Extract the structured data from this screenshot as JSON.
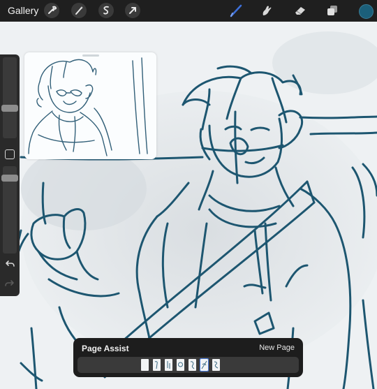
{
  "topbar": {
    "gallery_label": "Gallery",
    "tools_left": [
      {
        "icon": "wrench-icon",
        "name": "actions"
      },
      {
        "icon": "magic-wand-icon",
        "name": "adjustments"
      },
      {
        "icon": "selection-icon",
        "name": "selection"
      },
      {
        "icon": "arrow-cursor-icon",
        "name": "transform"
      }
    ],
    "tools_right": [
      {
        "icon": "brush-icon",
        "name": "brush",
        "active": true
      },
      {
        "icon": "smudge-icon",
        "name": "smudge"
      },
      {
        "icon": "eraser-icon",
        "name": "eraser"
      },
      {
        "icon": "layers-icon",
        "name": "layers"
      }
    ],
    "current_color": "#1b5f7a",
    "active_tool_color": "#3d6fd8"
  },
  "sidebar": {
    "brush_size_level": 0.4,
    "opacity_level": 0.15,
    "icons": [
      "square-modify-icon",
      "undo-icon",
      "redo-icon"
    ]
  },
  "reference_window": {
    "content": "reference-sketch"
  },
  "page_assist": {
    "title": "Page Assist",
    "new_page_label": "New Page",
    "page_count": 7,
    "active_page": 6
  },
  "colors": {
    "stroke": "#1d5670",
    "canvas_bg": "#e9edf0",
    "panel_bg": "#1d1d1d"
  }
}
